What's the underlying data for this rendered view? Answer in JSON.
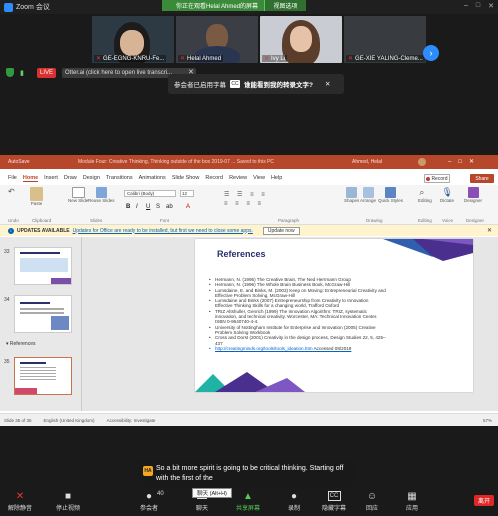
{
  "window": {
    "app_title": "Zoom 会议",
    "controls": [
      "–",
      "□",
      "✕"
    ]
  },
  "top_banner": {
    "speaking": "你正在观看Helal Ahmed的屏幕",
    "view_options": "视图选项"
  },
  "participants": [
    {
      "name": "GE-EGNG-KNRU-Fe...",
      "muted": true
    },
    {
      "name": "Helal Ahmed",
      "muted": true
    },
    {
      "name": "Ivy Li",
      "muted": true
    },
    {
      "name": "GE-XIE YALING-Cleme...",
      "muted": true
    }
  ],
  "status": {
    "live_label": "LIVE",
    "otter_text": "Otter.ai (click here to open live transcri...",
    "otter_close": "✕"
  },
  "caption_prompt": {
    "text": "参会者已启用字幕",
    "question": "谁能看到我的转录文字?",
    "close": "✕"
  },
  "powerpoint": {
    "autosave": "AutoSave",
    "doc_title": "Module Four: Creative Thinking, Thinking outside of the box 2019-07 ... Saved to this PC",
    "user": "Ahmed, Helal",
    "window_buttons": "–□✕",
    "tabs": [
      "File",
      "Home",
      "Insert",
      "Draw",
      "Design",
      "Transitions",
      "Animations",
      "Slide Show",
      "Record",
      "Review",
      "View",
      "Help"
    ],
    "active_tab": "Home",
    "record_btn": "Record",
    "share_btn": "Share",
    "ribbon": {
      "paste": "Paste",
      "new_slide": "New Slide",
      "reuse": "Reuse Slides",
      "font": "Calibri (Body)",
      "size": "12",
      "groups": [
        "Undo",
        "Clipboard",
        "Slides",
        "Font",
        "Paragraph",
        "Drawing",
        "Editing",
        "Voice",
        "Designer"
      ],
      "shapes": "Shapes",
      "arrange": "Arrange",
      "quick_styles": "Quick Styles",
      "editing": "Editing",
      "dictate": "Dictate",
      "designer": "Designer",
      "format_buttons": [
        "B",
        "I",
        "U",
        "S",
        "ab",
        "A"
      ]
    },
    "update_bar": {
      "label": "UPDATES AVAILABLE",
      "text": "Updates for Office are ready to be installed, but first we need to close some apps.",
      "button": "Update now",
      "close": "✕"
    },
    "slide_numbers": [
      "33",
      "34",
      "35"
    ],
    "section_label": "References",
    "slide": {
      "title": "References",
      "refs": [
        "Hermann, N. (1995) The Creative Brain, The Ned Herrmann Group",
        "Hermann, N. (1996) The Whole Brain Business Book, McGraw-Hill",
        "Lumsdaine, E. and Binks, M. (2003) Keep on Moving: Entrepreneurial Creativity and Effective Problem Solving, McGraw-Hill",
        "Lumsdaine and Binks (2007) Entrepreneurship from Creativity to Innovation Effective Thinking Skills for a changing world, Trafford Oxford",
        "TRIZ Altshuller, Genrich (1999) The Innovation Algorithm: TRIZ, systematic innovation, and technical creativity. Worcester, MA: Technical Innovation Center. ISBN 0-9640740-4-4.",
        "University of Nottingham Institute for Enterprise and Innovation (2005) Creative Problem Solving Workbook",
        "Cross and Dorst (2001) Creativity in the design process, Design Studies 22, 5, 425–437"
      ],
      "link": "http://creatingminds.org/tools/tools_ideation.htm",
      "link_suffix": " Accessed 08/2019"
    },
    "status_bar": {
      "slide_of": "Slide 35 of 35",
      "language": "English (United Kingdom)",
      "accessibility": "Accessibility: Investigate",
      "zoom": "57%"
    }
  },
  "subtitle": {
    "speaker_initials": "HA",
    "text": "So a bit more spirit is going to be critical thinking. Starting off with the first of the"
  },
  "tooltip": "聊天 (Alt+H)",
  "toolbar": {
    "items": [
      "解除静音",
      "停止视频",
      "参会者",
      "聊天",
      "共享屏幕",
      "录制",
      "隐藏字幕",
      "回应",
      "应用"
    ],
    "participant_count": "40",
    "leave": "离开"
  },
  "colors": {
    "accent": "#2d8cff",
    "live": "#d9312f",
    "share_green": "#4fcb4f",
    "ppt": "#b7472a",
    "leave": "#e02828"
  }
}
